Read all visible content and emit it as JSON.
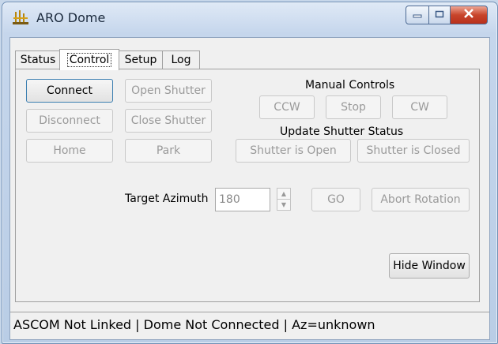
{
  "window": {
    "title": "ARO Dome",
    "icon": "telescope-dome-icon",
    "minimize_icon": "minimize-icon",
    "maximize_icon": "maximize-icon",
    "close_icon": "close-icon",
    "close_color": "#c8452b"
  },
  "tabs": [
    {
      "label": "Status",
      "active": false
    },
    {
      "label": "Control",
      "active": true
    },
    {
      "label": "Setup",
      "active": false
    },
    {
      "label": "Log",
      "active": false
    }
  ],
  "control": {
    "connect_label": "Connect",
    "disconnect_label": "Disconnect",
    "home_label": "Home",
    "open_shutter_label": "Open Shutter",
    "close_shutter_label": "Close Shutter",
    "park_label": "Park",
    "manual_controls_heading": "Manual Controls",
    "ccw_label": "CCW",
    "stop_label": "Stop",
    "cw_label": "CW",
    "update_shutter_heading": "Update Shutter Status",
    "shutter_open_label": "Shutter is Open",
    "shutter_closed_label": "Shutter is Closed",
    "target_azimuth_label": "Target Azimuth",
    "target_azimuth_value": "180",
    "go_label": "GO",
    "abort_rotation_label": "Abort Rotation",
    "hide_window_label": "Hide Window"
  },
  "statusbar": {
    "text": "ASCOM Not Linked | Dome Not Connected | Az=unknown"
  }
}
